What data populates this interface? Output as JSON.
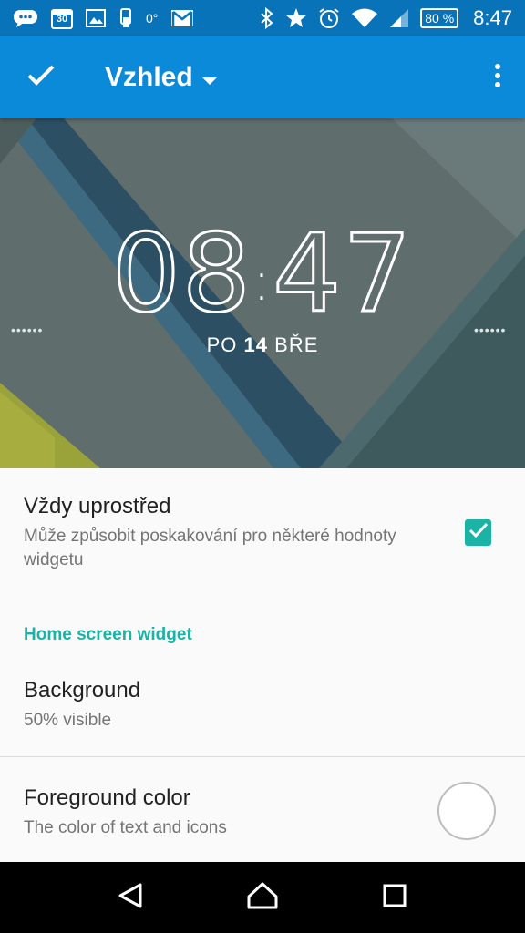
{
  "status_bar": {
    "calendar_day": "30",
    "temperature": "0°",
    "battery": "80 %",
    "time": "8:47",
    "icons": [
      "messages-icon",
      "calendar-icon",
      "gallery-icon",
      "phone-clip-icon",
      "gmail-icon",
      "bluetooth-icon",
      "star-icon",
      "alarm-icon",
      "wifi-icon",
      "signal-icon",
      "battery-icon"
    ]
  },
  "app_bar": {
    "title": "Vzhled",
    "confirm_icon": "check-icon",
    "dropdown_icon": "dropdown-arrow-icon",
    "overflow_icon": "more-vert-icon"
  },
  "preview": {
    "time_hours": "08",
    "time_separator": ":",
    "time_minutes": "47",
    "day_name": "PO",
    "day_number": "14",
    "month": "BŘE",
    "handle_left": "••••••",
    "handle_right": "••••••"
  },
  "settings": {
    "always_center": {
      "title": "Vždy uprostřed",
      "summary": "Může způsobit poskakování pro některé hodnoty widgetu",
      "checked": true
    },
    "section_header": "Home screen widget",
    "background": {
      "title": "Background",
      "summary": "50% visible"
    },
    "foreground_color": {
      "title": "Foreground color",
      "summary": "The color of text and icons",
      "swatch": "#ffffff"
    }
  },
  "colors": {
    "status_bar": "#0873b9",
    "app_bar": "#0b8ad9",
    "accent": "#1ab3a6"
  },
  "nav_bar": {
    "icons": [
      "back-icon",
      "home-icon",
      "recents-icon"
    ]
  }
}
